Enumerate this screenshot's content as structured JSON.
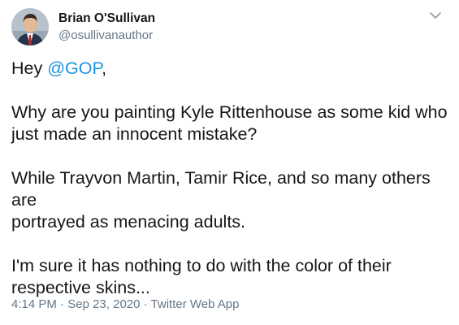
{
  "author": {
    "display_name": "Brian O'Sullivan",
    "handle": "@osullivanauthor"
  },
  "icons": {
    "caret": "chevron-down-icon"
  },
  "tweet": {
    "greeting_prefix": "Hey ",
    "mention": "@GOP",
    "greeting_suffix": ",",
    "para2_line1": "Why are you painting Kyle Rittenhouse as some kid who",
    "para2_line2": "just made an innocent mistake?",
    "para3_line1": "While Trayvon Martin, Tamir Rice, and so many others are",
    "para3_line2": "portrayed as menacing adults.",
    "para4_line1": "I'm sure it has nothing to do with the color of their",
    "para4_line2": "respective skins..."
  },
  "meta": {
    "time": "4:14 PM",
    "sep1": " · ",
    "date": "Sep 23, 2020",
    "sep2": " · ",
    "source": "Twitter Web App"
  },
  "colors": {
    "mention": "#1b95e0",
    "secondary_text": "#657786",
    "primary_text": "#14171a"
  }
}
